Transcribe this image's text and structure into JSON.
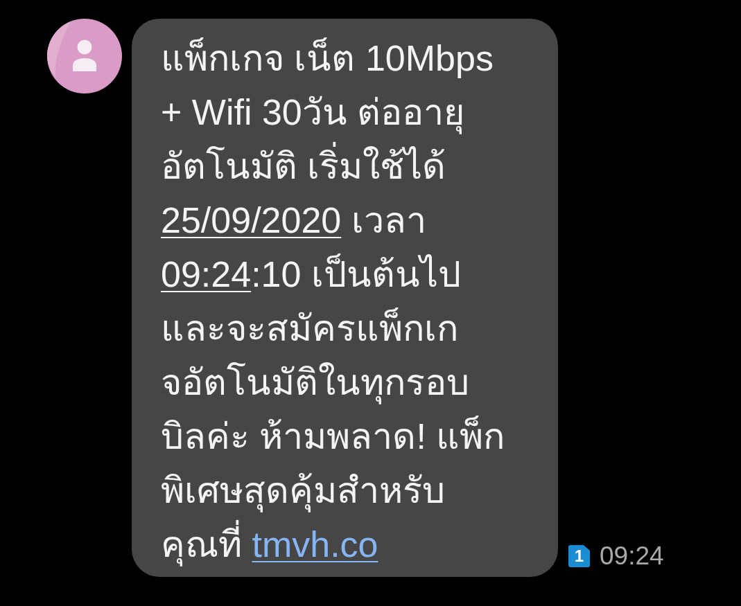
{
  "message": {
    "lines": [
      [
        {
          "kind": "text",
          "text": "แพ็กเกจ เน็ต 10Mbps"
        }
      ],
      [
        {
          "kind": "text",
          "text": "+ Wifi 30วัน ต่ออายุ"
        }
      ],
      [
        {
          "kind": "text",
          "text": "อัตโนมัติ เริ่มใช้ได้"
        }
      ],
      [
        {
          "kind": "datetime",
          "text": "25/09/2020"
        },
        {
          "kind": "text",
          "text": " เวลา"
        }
      ],
      [
        {
          "kind": "datetime",
          "text": "09:24"
        },
        {
          "kind": "text",
          "text": ":10 เป็นต้นไป"
        }
      ],
      [
        {
          "kind": "text",
          "text": "และจะสมัครแพ็กเก"
        }
      ],
      [
        {
          "kind": "text",
          "text": "จอัตโนมัติในทุกรอบ"
        }
      ],
      [
        {
          "kind": "text",
          "text": "บิลค่ะ ห้ามพลาด! แพ็ก"
        }
      ],
      [
        {
          "kind": "text",
          "text": "พิเศษสุดคุ้มสำหรับ"
        }
      ],
      [
        {
          "kind": "text",
          "text": "คุณที่ "
        },
        {
          "kind": "url",
          "text": "tmvh.co"
        }
      ]
    ]
  },
  "meta": {
    "sim": "1",
    "time": "09:24"
  }
}
